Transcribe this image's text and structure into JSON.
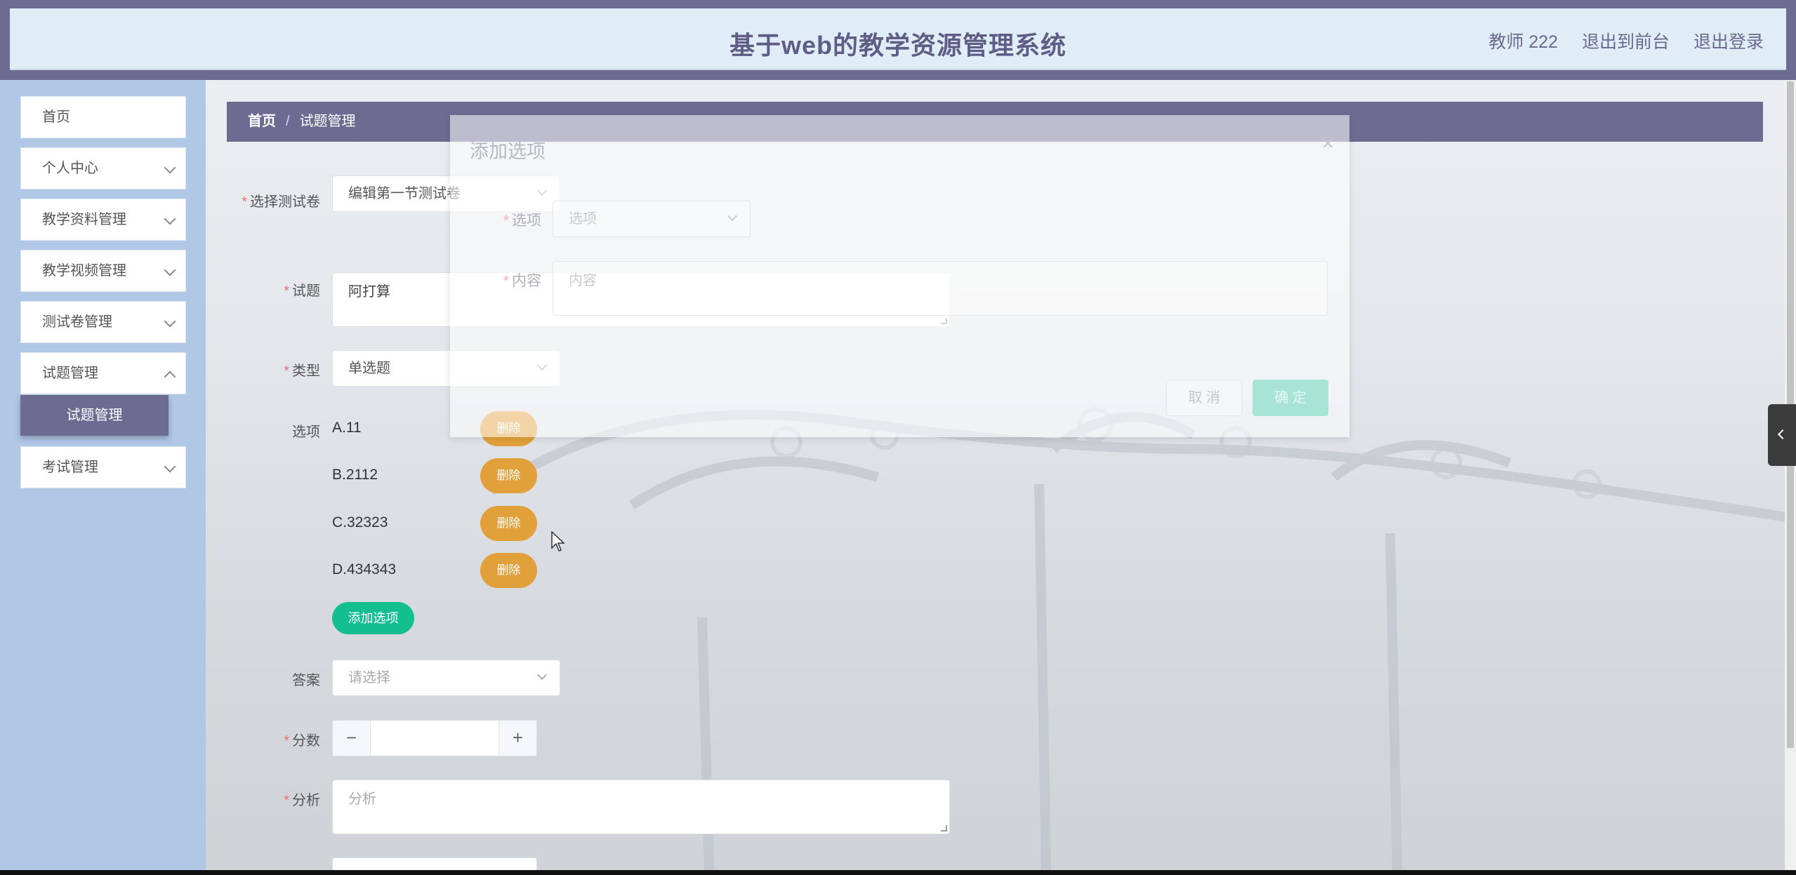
{
  "header": {
    "title": "基于web的教学资源管理系统",
    "user": "教师 222",
    "link_front": "退出到前台",
    "link_logout": "退出登录"
  },
  "sidebar": {
    "items": [
      {
        "label": "首页"
      },
      {
        "label": "个人中心"
      },
      {
        "label": "教学资料管理"
      },
      {
        "label": "教学视频管理"
      },
      {
        "label": "测试卷管理"
      },
      {
        "label": "试题管理"
      },
      {
        "label": "考试管理"
      }
    ],
    "active_sub": "试题管理"
  },
  "breadcrumb": {
    "home": "首页",
    "separator": "/",
    "current": "试题管理"
  },
  "form": {
    "paper_label": "选择测试卷",
    "paper_value": "编辑第一节测试卷",
    "question_label": "试题",
    "question_value": "阿打算",
    "type_label": "类型",
    "type_value": "单选题",
    "options_label": "选项",
    "options": [
      {
        "text": "A.11",
        "delete": "删除"
      },
      {
        "text": "B.2112",
        "delete": "删除"
      },
      {
        "text": "C.32323",
        "delete": "删除"
      },
      {
        "text": "D.434343",
        "delete": "删除"
      }
    ],
    "add_option": "添加选项",
    "answer_label": "答案",
    "answer_placeholder": "请选择",
    "score_label": "分数",
    "score_minus": "−",
    "score_plus": "+",
    "analysis_label": "分析",
    "analysis_placeholder": "分析"
  },
  "dialog": {
    "title": "添加选项",
    "close": "×",
    "option_label": "选项",
    "option_placeholder": "选项",
    "content_label": "内容",
    "content_placeholder": "内容",
    "cancel": "取 消",
    "confirm": "确 定"
  },
  "colors": {
    "primary": "#6e6b93",
    "sidebar_bg": "#b0c7e6",
    "delete": "#e2a03b",
    "add": "#13be8f"
  }
}
